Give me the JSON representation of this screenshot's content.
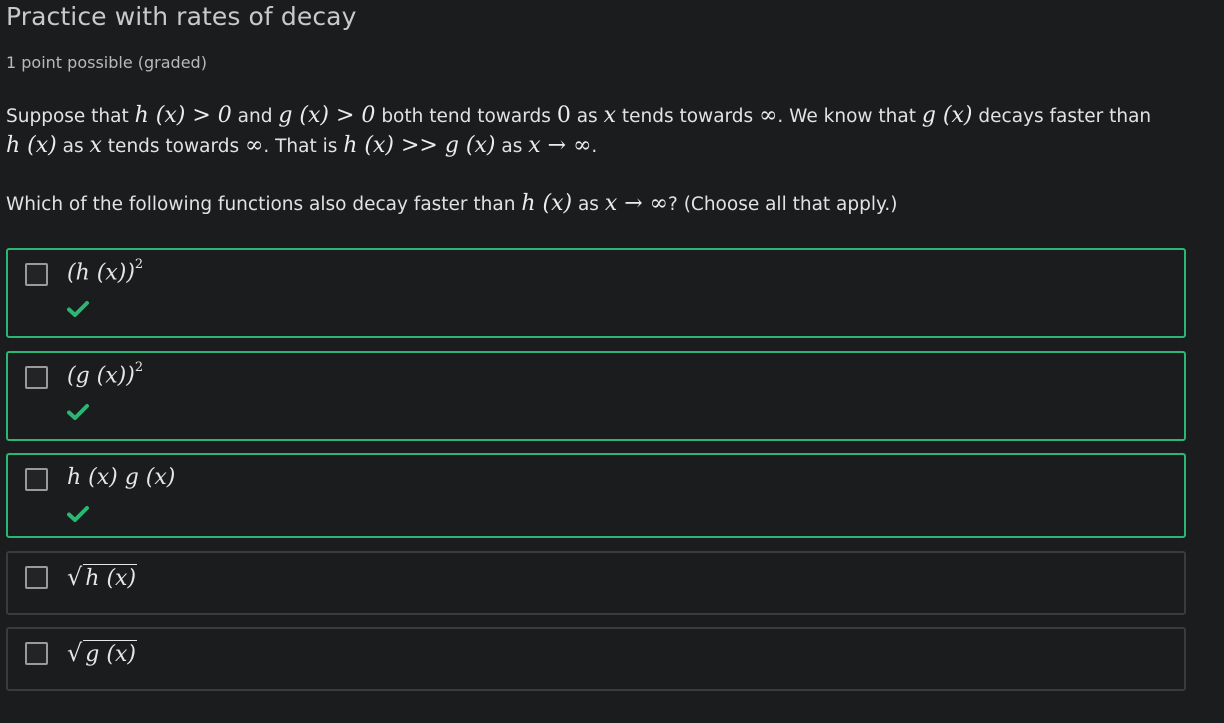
{
  "problem": {
    "title": "Practice with rates of decay",
    "points": "1 point possible (graded)",
    "para1": {
      "t1": "Suppose that ",
      "m1": "h (x) > 0",
      "t2": " and ",
      "m2": "g (x) > 0",
      "t3": " both tend towards ",
      "m3": "0",
      "t4": " as ",
      "m4": "x",
      "t5": " tends towards ",
      "m5": "∞",
      "t6": ". We know that ",
      "m6": "g (x)",
      "t7": " decays faster than"
    },
    "para2": {
      "m1": "h (x)",
      "t1": " as ",
      "m2": "x",
      "t2": " tends towards ",
      "m3": "∞",
      "t3": ". That is ",
      "m4": "h (x) >> g (x)",
      "t4": " as ",
      "m5": "x → ∞",
      "t5": "."
    },
    "question": {
      "t1": "Which of the following functions also decay faster than ",
      "m1": "h (x)",
      "t2": " as ",
      "m2": "x → ∞",
      "t3": "? (Choose all that apply.)"
    }
  },
  "choices": [
    {
      "base": "(h (x))",
      "sup": "2",
      "status": "correct"
    },
    {
      "base": "(g (x))",
      "sup": "2",
      "status": "correct"
    },
    {
      "base": "h (x) g (x)",
      "status": "correct"
    },
    {
      "radicand": "h (x)",
      "status": "none"
    },
    {
      "radicand": "g (x)",
      "status": "none"
    }
  ],
  "colors": {
    "correct": "#2bb673",
    "checkmark": "#2bb673",
    "background": "#1b1c1d"
  },
  "icons": {
    "check": "check-icon",
    "checkbox": "checkbox-icon",
    "radical": "√"
  }
}
